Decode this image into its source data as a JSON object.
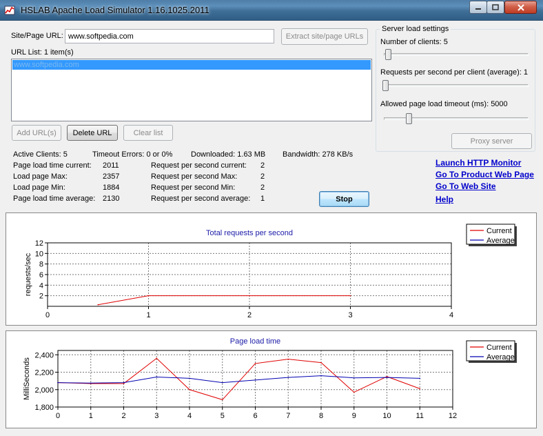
{
  "window": {
    "title": "HSLAB Apache Load Simulator 1.16.1025.2011"
  },
  "site": {
    "label": "Site/Page URL:",
    "value": "www.softpedia.com",
    "extract_label": "Extract site/page URLs"
  },
  "url_list": {
    "label": "URL List: 1 item(s)",
    "items": [
      "www.softpedia.com"
    ],
    "add_label": "Add URL(s)",
    "delete_label": "Delete URL",
    "clear_label": "Clear list"
  },
  "server": {
    "title": "Server load settings",
    "clients_label": "Number of clients: 5",
    "rps_label": "Requests per second per client (average): 1",
    "timeout_label": "Allowed page load timeout (ms): 5000",
    "proxy_label": "Proxy server",
    "clients_level": 0.02,
    "rps_level": 0.0,
    "timeout_level": 0.17
  },
  "stats": {
    "active_clients": "Active Clients: 5",
    "timeout_errors": "Timeout Errors: 0 or 0%",
    "downloaded": "Downloaded: 1.63 MB",
    "bandwidth": "Bandwidth: 278 KB/s",
    "left_labels": [
      "Page load time current:",
      "Load page Max:",
      "Load page Min:",
      "Page load time average:"
    ],
    "left_values": [
      "2011",
      "2357",
      "1884",
      "2130"
    ],
    "right_labels": [
      "Request per second current:",
      "Request per second Max:",
      "Request per second Min:",
      "Request per second average:"
    ],
    "right_values": [
      "2",
      "2",
      "2",
      "1"
    ]
  },
  "stop_label": "Stop",
  "links": [
    "Launch HTTP Monitor",
    "Go To Product Web Page",
    "Go To Web Site",
    "Help"
  ],
  "chart_data": [
    {
      "type": "line",
      "title": "Total requests per second",
      "ylabel": "requests/sec",
      "xlabel": "",
      "xlim": [
        0,
        4
      ],
      "ylim": [
        0,
        12
      ],
      "xticks": [
        "0",
        "1",
        "2",
        "3",
        "4"
      ],
      "yticks": [
        "2",
        "4",
        "6",
        "8",
        "10",
        "12"
      ],
      "grid": true,
      "legend": "top-right",
      "series": [
        {
          "name": "Current",
          "color": "#e00000",
          "x": [
            0.5,
            1,
            2,
            3
          ],
          "y": [
            0.3,
            2,
            2,
            2
          ]
        },
        {
          "name": "Average",
          "color": "#0000b0",
          "x": [],
          "y": []
        }
      ]
    },
    {
      "type": "line",
      "title": "Page load time",
      "ylabel": "MilliSeconds",
      "xlabel": "",
      "xlim": [
        0,
        12
      ],
      "ylim": [
        1800,
        2450
      ],
      "xticks": [
        "0",
        "1",
        "2",
        "3",
        "4",
        "5",
        "6",
        "7",
        "8",
        "9",
        "10",
        "11",
        "12"
      ],
      "yticks": [
        "1,800",
        "2,000",
        "2,200",
        "2,400"
      ],
      "grid": true,
      "legend": "top-right",
      "series": [
        {
          "name": "Current",
          "color": "#e00000",
          "x": [
            0,
            1,
            2,
            3,
            4,
            5,
            6,
            7,
            8,
            9,
            10,
            11
          ],
          "y": [
            2080,
            2070,
            2070,
            2360,
            2000,
            1884,
            2300,
            2350,
            2310,
            1970,
            2150,
            2011
          ]
        },
        {
          "name": "Average",
          "color": "#0000b0",
          "x": [
            0,
            1,
            2,
            3,
            4,
            5,
            6,
            7,
            8,
            9,
            10,
            11
          ],
          "y": [
            2080,
            2075,
            2080,
            2145,
            2130,
            2080,
            2110,
            2140,
            2160,
            2135,
            2140,
            2130
          ]
        }
      ]
    }
  ]
}
